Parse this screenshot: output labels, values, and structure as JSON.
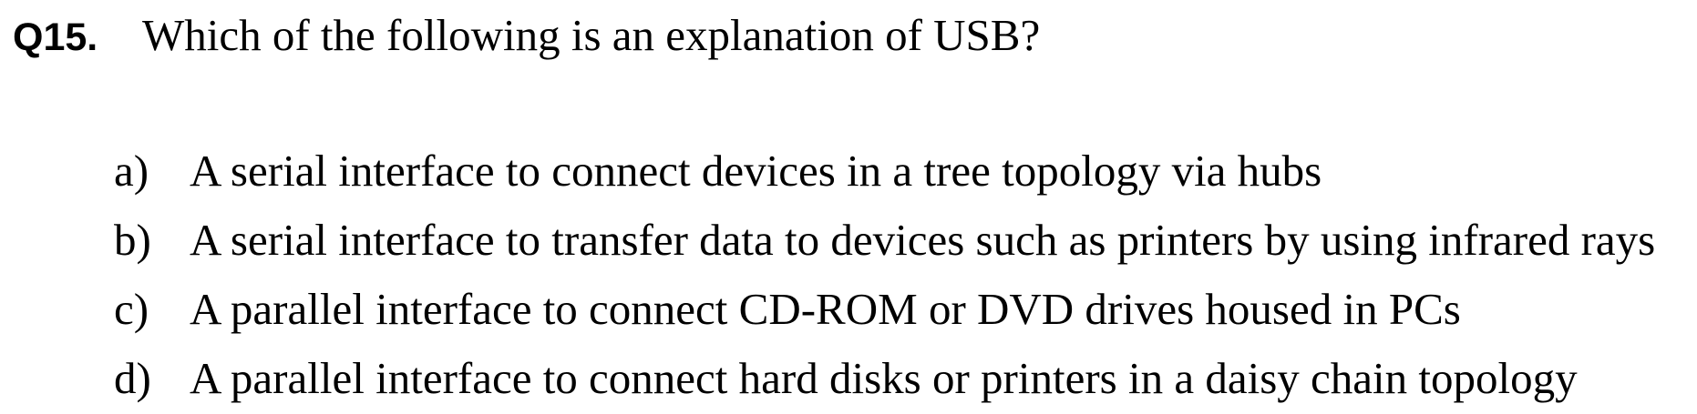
{
  "question": {
    "number": "Q15.",
    "text": "Which of the following is an explanation of USB?"
  },
  "options": [
    {
      "label": "a)",
      "text": "A serial interface to connect devices in a tree topology via hubs"
    },
    {
      "label": "b)",
      "text": "A serial interface to transfer data to devices such as printers by using infrared rays"
    },
    {
      "label": "c)",
      "text": "A parallel interface to connect CD-ROM or DVD drives housed in PCs"
    },
    {
      "label": "d)",
      "text": "A parallel interface to connect hard disks or printers in a daisy chain topology"
    }
  ]
}
